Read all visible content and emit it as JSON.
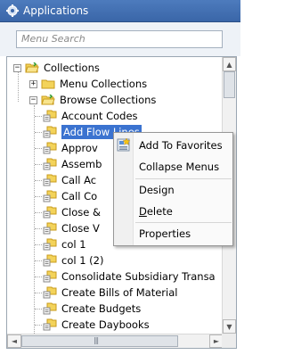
{
  "window": {
    "title": "Applications",
    "title_icon": "gear-icon"
  },
  "search": {
    "placeholder": "Menu Search",
    "value": ""
  },
  "tree": {
    "root": {
      "label": "Collections",
      "expander": "−"
    },
    "children": [
      {
        "label": "Menu Collections",
        "expander": "+"
      },
      {
        "label": "Browse Collections",
        "expander": "−"
      }
    ],
    "items": [
      "Account Codes",
      "Add Flow Lines",
      "Approv",
      "Assemb",
      "Call Ac",
      "Call Co",
      "Close &",
      "Close V",
      "col 1",
      "col 1 (2)",
      "Consolidate Subsidiary Transa",
      "Create Bills of Material",
      "Create Budgets",
      "Create Daybooks"
    ],
    "selected_index": 1
  },
  "context_menu": {
    "items": [
      {
        "label": "Add To Favorites",
        "icon": "favorites-icon"
      },
      {
        "label": "Collapse Menus"
      },
      {
        "label": "Design"
      },
      {
        "label_prefix": "",
        "accel": "D",
        "label_rest": "elete"
      },
      {
        "label": "Properties"
      }
    ]
  },
  "scrollbars": {
    "v_up": "▲",
    "v_down": "▼",
    "h_left": "◄",
    "h_right": "►",
    "grip": "|||"
  }
}
